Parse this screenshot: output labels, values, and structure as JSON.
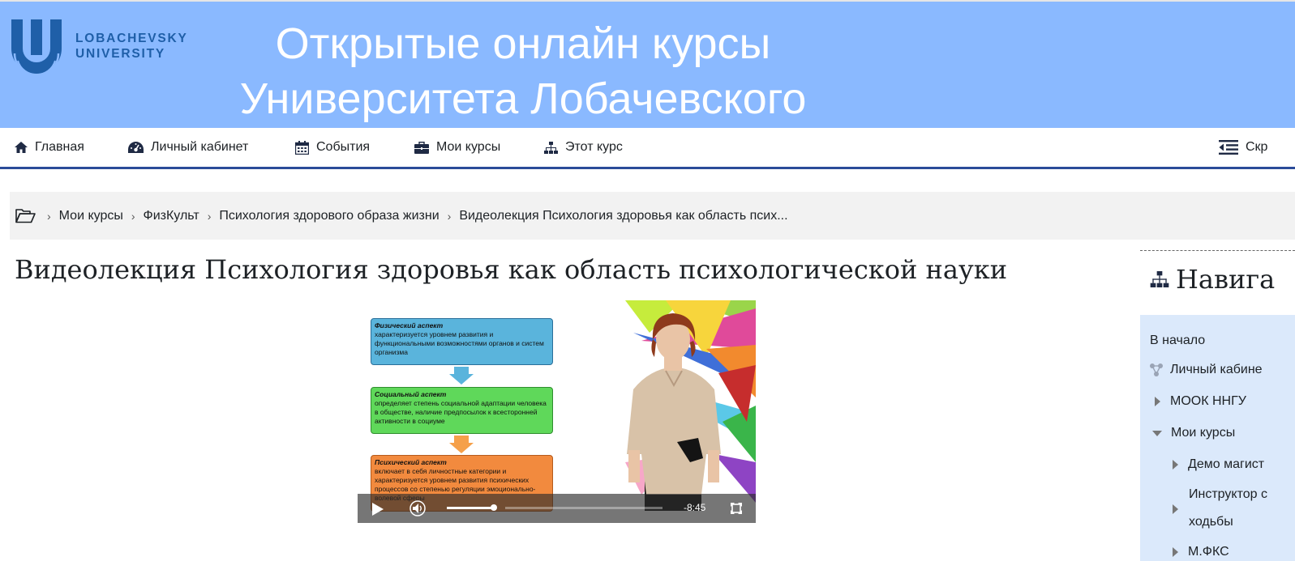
{
  "header": {
    "logo_line1": "LOBACHEVSKY",
    "logo_line2": "UNIVERSITY",
    "title_line1": "Открытые онлайн курсы",
    "title_line2": "Университета Лобачевского",
    "bg_color": "#8ab9ff",
    "logo_color": "#1f5fa8"
  },
  "nav": {
    "home": "Главная",
    "dashboard": "Личный кабинет",
    "events": "События",
    "my_courses": "Мои курсы",
    "this_course": "Этот курс",
    "hide": "Скр"
  },
  "breadcrumb": {
    "items": [
      "Мои курсы",
      "ФизКульт",
      "Психология здорового образа жизни",
      "Видеолекция Психология здоровья как область псих..."
    ]
  },
  "page": {
    "title": "Видеолекция Психология здоровья как область психологической науки"
  },
  "video": {
    "slide": {
      "box1_head": "Физический аспект",
      "box1_text": "характеризуется уровнем развития и функциональными возможностями органов и систем организма",
      "box2_head": "Социальный аспект",
      "box2_text": "определяет степень социальной адаптации человека в обществе, наличие предпосылок к всесторонней активности в социуме",
      "box3_head": "Психический аспект",
      "box3_text": "включает в себя личностные категории и характеризуется уровнем развития психических процессов со степенью регуляции эмоционально-волевой сферы"
    },
    "time_remaining": "-8:45",
    "volume_level": 0.8,
    "progress_level": 0.0
  },
  "sidebar": {
    "heading": "Навига",
    "items": [
      {
        "label": "В начало"
      },
      {
        "label": "Личный кабине"
      },
      {
        "label": "МООК ННГУ"
      },
      {
        "label": "Мои курсы"
      },
      {
        "label": "Демо магист"
      },
      {
        "label": "Инструктор с"
      },
      {
        "label": "ходьбы"
      },
      {
        "label": "М.ФКС"
      }
    ]
  }
}
